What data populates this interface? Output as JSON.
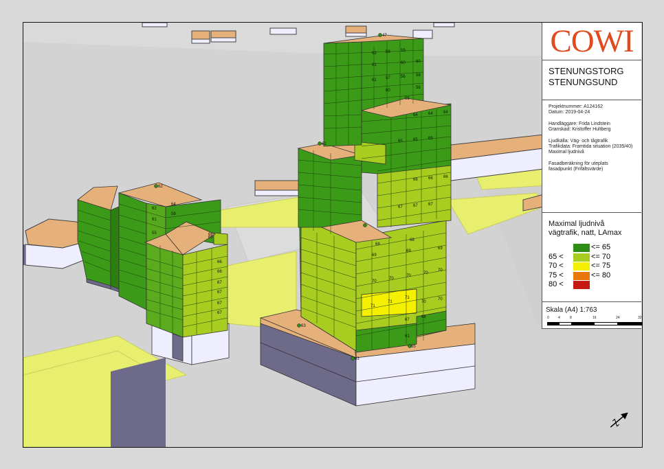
{
  "logo": "COWI",
  "project": {
    "title1": "STENUNGSTORG",
    "title2": "STENUNGSUND"
  },
  "info": {
    "line1": "Projektnummer: A124162",
    "line2": "Datum: 2019-04-24",
    "line3": "Handläggare: Frida Lindstein",
    "line4": "Granskad: Kristoffer Hultberg",
    "line5": "Ljudkälla: Väg- och tågtrafik",
    "line6": "Trafikdata: Framtida situation (2035/40)",
    "line7": "Maximal ljudnivå",
    "line8": "Fasadberäkning för uteplats",
    "line9": "fasadpunkt (Frifältsvärde)"
  },
  "legend": {
    "title1": "Maximal ljudnivå",
    "title2": "vägtrafik, natt, LAmax",
    "classes": [
      {
        "lo": "",
        "hi": "<= 65",
        "color": "#2f8f12"
      },
      {
        "lo": "65 <",
        "hi": "<= 70",
        "color": "#a8cc20"
      },
      {
        "lo": "70 <",
        "hi": "<= 75",
        "color": "#f4f000"
      },
      {
        "lo": "75 <",
        "hi": "<= 80",
        "color": "#e8780c"
      },
      {
        "lo": "80 <",
        "hi": "",
        "color": "#c41a12"
      }
    ]
  },
  "scale": {
    "label": "Skala (A4) 1:763",
    "ticks": [
      "0",
      "4",
      "8",
      "16",
      "24",
      "32"
    ]
  },
  "map_labels": {
    "p47": "47",
    "p61": "61",
    "p62": "62",
    "p63a": "63",
    "p63b": "63",
    "p65": "65",
    "p66": "66"
  },
  "facade_values": {
    "left_a": [
      "62",
      "64",
      "61",
      "58",
      "55"
    ],
    "left_b": [
      "65",
      "66",
      "66",
      "67",
      "67",
      "67",
      "67"
    ],
    "tower_top": [
      "62",
      "59",
      "59",
      "61",
      "60",
      "60",
      "61",
      "57",
      "56",
      "58",
      "60",
      "56",
      "55"
    ],
    "tower_mid": [
      "64",
      "64",
      "64",
      "65",
      "65",
      "65",
      "66",
      "66",
      "66",
      "67",
      "67",
      "67"
    ],
    "tower_low": [
      "68",
      "68",
      "69",
      "69",
      "69",
      "70",
      "70",
      "70",
      "70",
      "70",
      "71",
      "71",
      "71",
      "70",
      "70",
      "67",
      "68",
      "61"
    ]
  }
}
